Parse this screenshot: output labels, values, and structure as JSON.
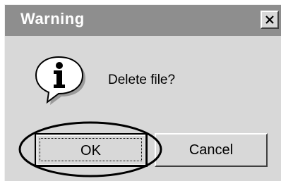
{
  "dialog": {
    "title": "Warning",
    "close_symbol": "×",
    "icon": "info-icon",
    "message": "Delete file?",
    "buttons": {
      "ok": "OK",
      "cancel": "Cancel"
    }
  },
  "colors": {
    "titlebar": "#8e8e8e",
    "title_text": "#ffffff",
    "dialog_bg": "#d8d8d8",
    "annotation": "#000000"
  },
  "annotation": {
    "shape": "ellipse",
    "target": "ok-button"
  }
}
